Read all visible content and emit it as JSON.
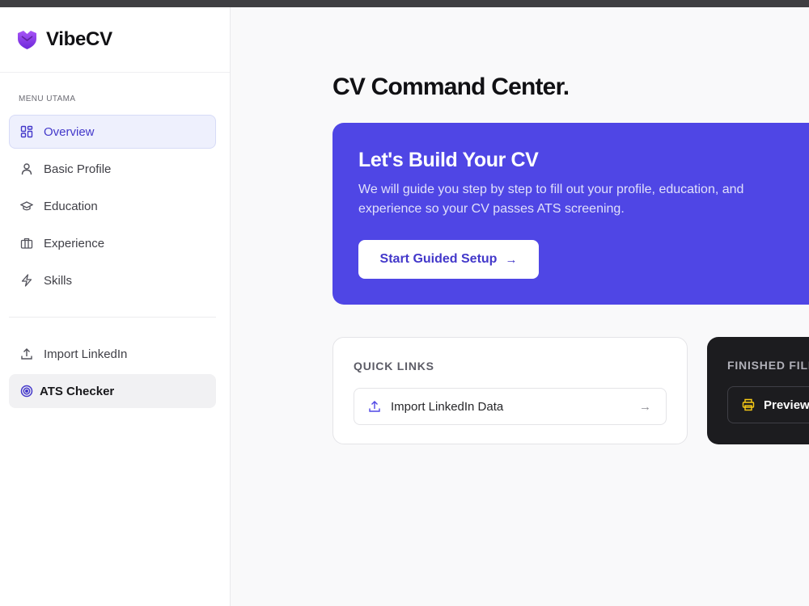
{
  "app": {
    "name": "VibeCV",
    "logo_icon": "heart-shield-icon"
  },
  "sidebar": {
    "menu_label": "MENU UTAMA",
    "items": [
      {
        "label": "Overview",
        "icon": "grid-icon",
        "active": true
      },
      {
        "label": "Basic Profile",
        "icon": "user-icon"
      },
      {
        "label": "Education",
        "icon": "graduation-cap-icon"
      },
      {
        "label": "Experience",
        "icon": "briefcase-icon"
      },
      {
        "label": "Skills",
        "icon": "lightning-icon"
      }
    ],
    "secondary": [
      {
        "label": "Import LinkedIn",
        "icon": "upload-icon"
      },
      {
        "label": "ATS Checker",
        "icon": "target-icon"
      }
    ]
  },
  "main": {
    "title": "CV Command Center.",
    "hero": {
      "title": "Let's Build Your CV",
      "description": "We will guide you step by step to fill out your profile, education, and experience so your CV passes ATS screening.",
      "button_label": "Start Guided Setup",
      "button_arrow": "→"
    },
    "quick_links": {
      "label": "QUICK LINKS",
      "items": [
        {
          "label": "Import LinkedIn Data",
          "icon": "upload-icon",
          "arrow": "→"
        }
      ]
    },
    "finished": {
      "label": "FINISHED FILL",
      "button_label": "Preview",
      "icon": "printer-icon"
    }
  },
  "colors": {
    "accent": "#4f46e5",
    "accent_text": "#4338ca",
    "dark_card": "#1c1c1f",
    "printer_icon": "#facc15"
  }
}
